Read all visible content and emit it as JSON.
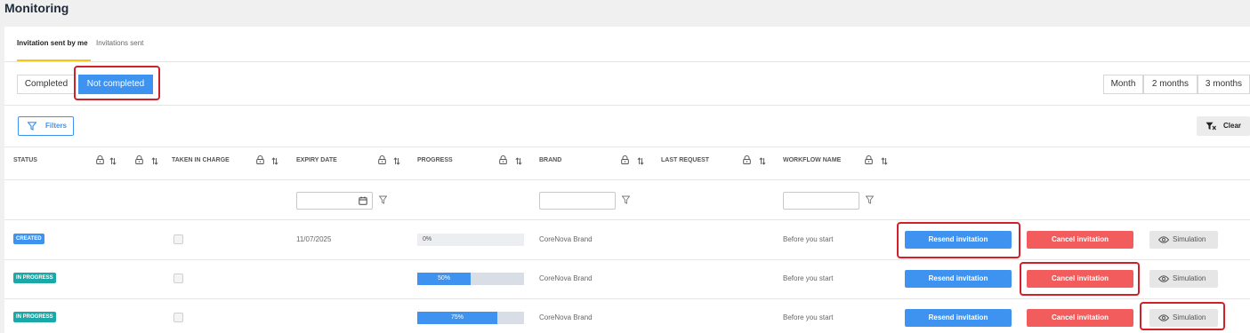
{
  "page": {
    "title": "Monitoring"
  },
  "tabs": [
    {
      "label": "Invitation sent by me",
      "active": true
    },
    {
      "label": "Invitations sent",
      "active": false
    }
  ],
  "status_filter": {
    "completed_label": "Completed",
    "not_completed_label": "Not completed",
    "selected": "Not completed"
  },
  "period": [
    "Month",
    "2 months",
    "3 months"
  ],
  "toolbar": {
    "filters_label": "Filters",
    "clear_label": "Clear",
    "filter_icon": "funnel-icon",
    "clear_icon": "funnel-clear-icon"
  },
  "columns": {
    "status": "STATUS",
    "taken_in_charge": "TAKEN IN CHARGE",
    "expiry_date": "EXPIRY DATE",
    "progress": "PROGRESS",
    "brand": "BRAND",
    "last_request": "LAST REQUEST",
    "workflow_name": "WORKFLOW NAME"
  },
  "actions": {
    "resend": "Resend invitation",
    "cancel": "Cancel invitation",
    "simulation": "Simulation"
  },
  "rows": [
    {
      "status": "CREATED",
      "expiry_date": "11/07/2025",
      "progress": 0,
      "progress_label": "0%",
      "brand": "CoreNova Brand",
      "workflow": "Before you start"
    },
    {
      "status": "IN PROGRESS",
      "expiry_date": "",
      "progress": 50,
      "progress_label": "50%",
      "brand": "CoreNova Brand",
      "workflow": "Before you start"
    },
    {
      "status": "IN PROGRESS",
      "expiry_date": "",
      "progress": 75,
      "progress_label": "75%",
      "brand": "CoreNova Brand",
      "workflow": "Before you start"
    }
  ],
  "colors": {
    "primary": "#3f93f0",
    "danger": "#f25c5c",
    "highlight": "#d31f2a",
    "tab_underline": "#f5c518",
    "in_progress_badge": "#1aa8a8"
  }
}
